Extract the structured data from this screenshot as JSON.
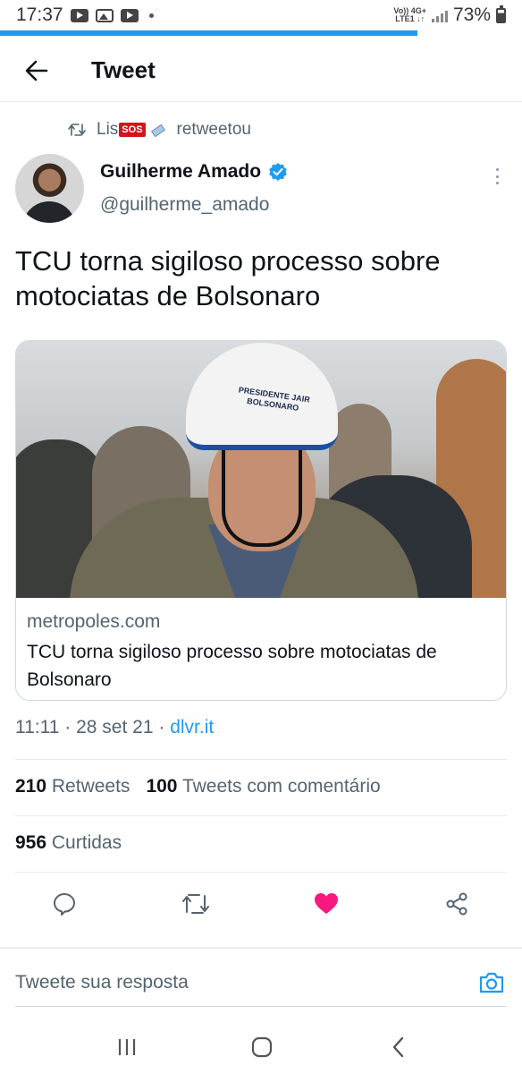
{
  "status_bar": {
    "time": "17:37",
    "network": "VoLTE 4G+ LTE1",
    "battery": "73%",
    "battery_level": 0.73,
    "icons": [
      "youtube-icon",
      "gallery-icon",
      "youtube-icon",
      "notification-dot-icon",
      "signal-icon",
      "battery-icon"
    ]
  },
  "load_progress": 0.8,
  "header": {
    "title": "Tweet",
    "back_icon": "arrow-left-icon"
  },
  "retweet": {
    "user": "Lis",
    "badge": "SOS",
    "label": "retweetou",
    "icon": "retweet-icon"
  },
  "author": {
    "name": "Guilherme Amado",
    "handle": "@guilherme_amado",
    "verified": true,
    "more_icon": "more-vertical-icon"
  },
  "tweet": {
    "text": "TCU torna sigiloso processo sobre motociatas de Bolsonaro",
    "time": "11:11",
    "date": "28 set 21",
    "source": "dlvr.it"
  },
  "card": {
    "domain": "metropoles.com",
    "title": "TCU torna sigiloso processo sobre motociatas de Bolsonaro",
    "helmet_text": "PRESIDENTE JAIR BOLSONARO"
  },
  "stats": {
    "retweets_count": "210",
    "retweets_label": "Retweets",
    "quotes_count": "100",
    "quotes_label": "Tweets com comentário",
    "likes_count": "956",
    "likes_label": "Curtidas"
  },
  "actions": {
    "icons": [
      "reply-icon",
      "retweet-icon",
      "like-icon",
      "share-icon"
    ],
    "like_color": "#f91880"
  },
  "reply": {
    "placeholder": "Tweete sua resposta",
    "camera_icon": "camera-icon"
  },
  "nav": {
    "icons": [
      "recents-icon",
      "home-icon",
      "back-icon"
    ]
  },
  "colors": {
    "accent": "#1d9bf0",
    "text": "#0f1419",
    "muted": "#536471"
  }
}
